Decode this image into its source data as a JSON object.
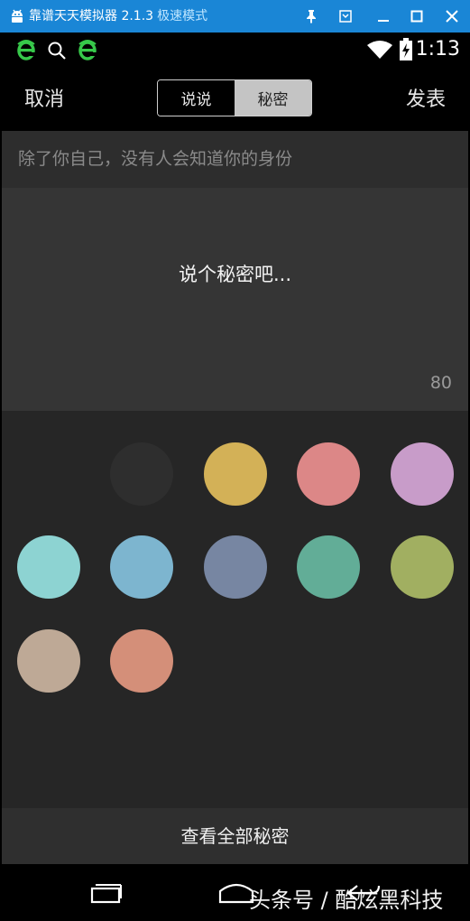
{
  "emulator": {
    "title": "靠谱天天模拟器 2.1.3",
    "mode": "极速模式"
  },
  "status": {
    "time": "1:13"
  },
  "header": {
    "cancel": "取消",
    "tabs": [
      "说说",
      "秘密"
    ],
    "active_tab": "秘密",
    "publish": "发表"
  },
  "hint": "除了你自己，没有人会知道你的身份",
  "composer": {
    "placeholder": "说个秘密吧...",
    "remaining": "80"
  },
  "colors": [
    "#2e2e2e",
    "#d3b157",
    "#dc8787",
    "#c89cc9",
    "#8dd3d2",
    "#7db5cf",
    "#7786a2",
    "#62ad97",
    "#a1af61",
    "#bea996",
    "#d48f79"
  ],
  "view_all": "查看全部秘密",
  "watermark": "头条号 / 酷炫黑科技"
}
